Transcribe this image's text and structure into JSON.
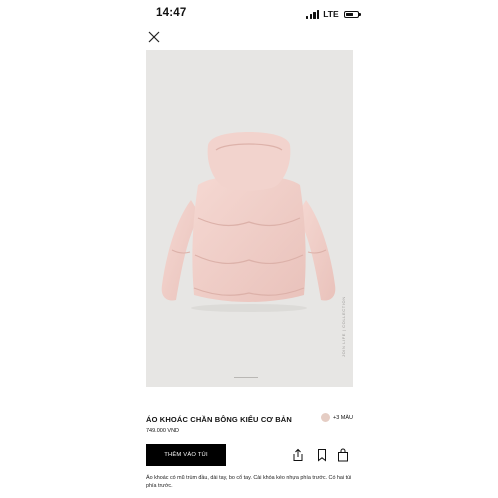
{
  "status_bar": {
    "time": "14:47",
    "network": "LTE",
    "signal_bars_filled": 4,
    "battery_level": 0.7
  },
  "header": {
    "close_icon": "close-icon"
  },
  "gallery": {
    "image": "pink hooded puffer jacket, back view",
    "vertical_label": "JOIN LIFE | COLLECTION",
    "background_color": "#e7e6e4"
  },
  "product": {
    "title": "ÁO KHOÁC CHẦN BÔNG KIỂU CƠ BẢN",
    "price": "749.000 VND",
    "swatch_color": "#e5cdc4",
    "more_colors": "+3 MÀU",
    "description": "Áo khoác có mũ trùm đầu, dài tay, bo cổ tay. Cài khóa kéo nhựa phía trước. Có hai túi phía trước."
  },
  "actions": {
    "add_to_cart_label": "THÊM VÀO TÚI",
    "share_icon": "share-icon",
    "bookmark_icon": "bookmark-icon",
    "shopping_bag_icon": "shopping-bag-icon"
  },
  "colors": {
    "button_bg": "#000000",
    "jacket": "#f0cfc9"
  }
}
